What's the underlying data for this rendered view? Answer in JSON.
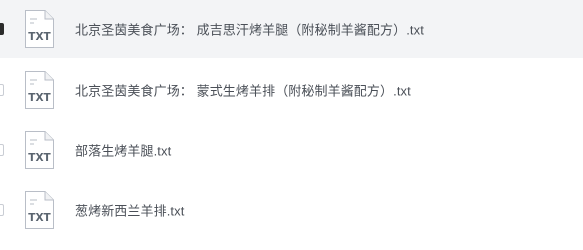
{
  "file_list": {
    "items": [
      {
        "name": "北京圣茵美食广场： 成吉思汗烤羊腿（附秘制羊酱配方）.txt",
        "type_label": "TXT",
        "icon": "txt-file-icon",
        "hovered": true,
        "checked": true
      },
      {
        "name": "北京圣茵美食广场： 蒙式生烤羊排（附秘制羊酱配方）.txt",
        "type_label": "TXT",
        "icon": "txt-file-icon",
        "hovered": false,
        "checked": false
      },
      {
        "name": "部落生烤羊腿.txt",
        "type_label": "TXT",
        "icon": "txt-file-icon",
        "hovered": false,
        "checked": false
      },
      {
        "name": "葱烤新西兰羊排.txt",
        "type_label": "TXT",
        "icon": "txt-file-icon",
        "hovered": false,
        "checked": false
      }
    ]
  },
  "colors": {
    "hover_background": "#f3f4f6",
    "text": "#4a4f57",
    "icon_stroke": "#b9bec7",
    "icon_label": "#5b6570"
  }
}
